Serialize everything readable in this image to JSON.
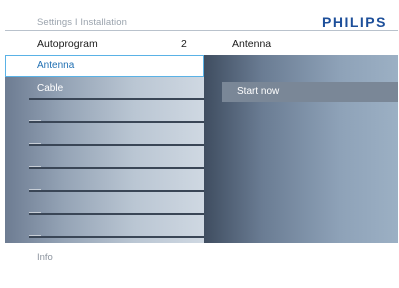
{
  "header": {
    "breadcrumb": "Settings I Installation",
    "brand": "PHILIPS"
  },
  "columns": {
    "left_title": "Autoprogram",
    "left_value": "2",
    "right_title": "Antenna"
  },
  "menu": {
    "items": [
      {
        "label": "Antenna",
        "selected": true
      },
      {
        "label": "Cable",
        "selected": false
      },
      {
        "label": "",
        "selected": false
      },
      {
        "label": "",
        "selected": false
      },
      {
        "label": "",
        "selected": false
      },
      {
        "label": "",
        "selected": false
      },
      {
        "label": "",
        "selected": false
      },
      {
        "label": "",
        "selected": false
      }
    ]
  },
  "right_panel": {
    "options": [
      {
        "label": "Start now"
      }
    ]
  },
  "footer": {
    "info": "Info"
  },
  "colors": {
    "brand": "#1d4f9a",
    "selection_border": "#5ab2e6",
    "selected_text": "#1f6fb2"
  }
}
